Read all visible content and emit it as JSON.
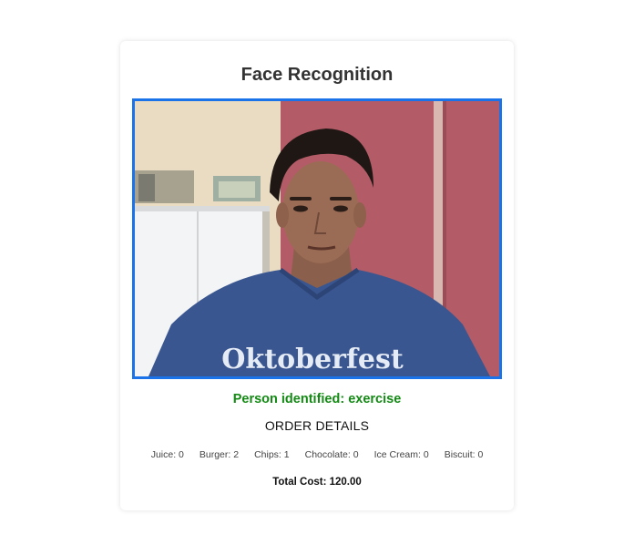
{
  "title": "Face Recognition",
  "status_text": "Person identified: exercise",
  "order": {
    "heading": "ORDER DETAILS",
    "items": [
      {
        "label": "Juice: 0"
      },
      {
        "label": "Burger: 2"
      },
      {
        "label": "Chips: 1"
      },
      {
        "label": "Chocolate: 0"
      },
      {
        "label": "Ice Cream: 0"
      },
      {
        "label": "Biscuit: 0"
      }
    ],
    "total": "Total Cost: 120.00"
  },
  "colors": {
    "frame_border": "#1a73e8",
    "status_text": "#138a13"
  }
}
